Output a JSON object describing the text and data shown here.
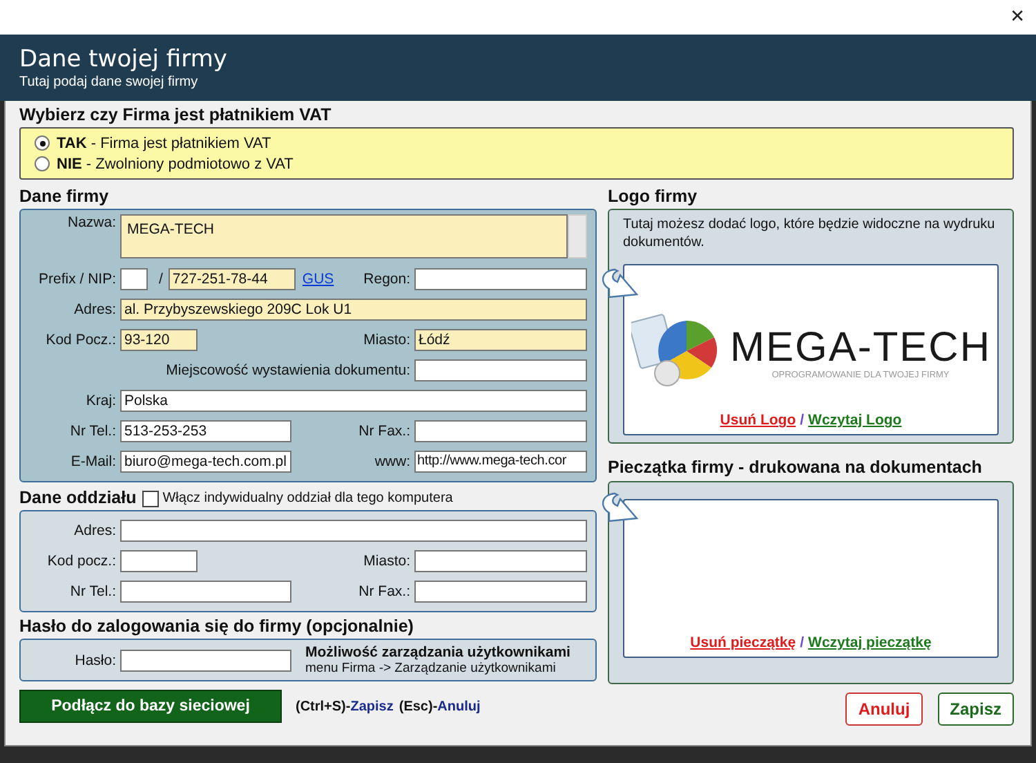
{
  "window": {
    "close": "✕"
  },
  "header": {
    "title": "Dane twojej firmy",
    "subtitle": "Tutaj podaj dane swojej firmy"
  },
  "vat": {
    "heading": "Wybierz czy Firma jest płatnikiem VAT",
    "options": [
      {
        "label": "**TAK** - Firma jest płatnikiem VAT",
        "selected": true
      },
      {
        "label": "**NIE** - Zwolniony podmiotowo z VAT",
        "selected": false
      }
    ]
  },
  "firm": {
    "heading": "Dane firmy",
    "name": {
      "label": "Nazwa:",
      "value": "MEGA-TECH",
      "required": true
    },
    "prefix": {
      "label": "Prefix / NIP:",
      "required": false
    },
    "separator": "/",
    "nip": {
      "value": "727-251-78-44",
      "required": true
    },
    "gus": "GUS",
    "regon": {
      "label": "Regon:",
      "required": false
    },
    "address": {
      "label": "Adres:",
      "value": "al. Przybyszewskiego 209C Lok U1",
      "required": true
    },
    "postcode": {
      "label": "Kod Pocz.:",
      "value": "93-120",
      "required": true
    },
    "city": {
      "label": "Miasto:",
      "value": "Łódź",
      "required": true
    },
    "issue_place": {
      "label": "Miejscowość wystawienia dokumentu:",
      "required": false
    },
    "country": {
      "label": "Kraj:",
      "value": "Polska",
      "required": false
    },
    "phone": {
      "label": "Nr Tel.:",
      "value": "513-253-253",
      "required": false
    },
    "fax": {
      "label": "Nr Fax.:",
      "required": false
    },
    "email": {
      "label": "E-Mail:",
      "value": "biuro@mega-tech.com.pl",
      "required": false
    },
    "www": {
      "label": "www:",
      "value": "http://www.mega-tech.cor",
      "required": false
    }
  },
  "branch": {
    "heading": "Dane oddziału",
    "checkbox": {
      "label": "Włącz indywidualny oddział dla tego komputera",
      "checked": false
    },
    "address": "Adres:",
    "postcode": "Kod pocz.:",
    "city": "Miasto:",
    "phone": "Nr Tel.:",
    "fax": "Nr Fax.:"
  },
  "password": {
    "heading": "Hasło do zalogowania się do firmy (opcjonalnie)",
    "label": "Hasło:",
    "note_title": "Możliwość zarządzania użytkownikami",
    "note": "menu Firma -> Zarządzanie użytkownikami"
  },
  "logo": {
    "heading": "Logo firmy",
    "hint": "Tutaj możesz dodać logo, które będzie widoczne na wydruku dokumentów.",
    "brand": "MEGA-TECH",
    "tagline": "OPROGRAMOWANIE DLA TWOJEJ FIRMY",
    "remove": "Usuń Logo",
    "slash": "/",
    "load": "Wczytaj Logo"
  },
  "stamp": {
    "heading": "Pieczątka firmy - drukowana na dokumentach",
    "remove": "Usuń pieczątkę",
    "slash": "/",
    "load": "Wczytaj pieczątkę"
  },
  "footer": {
    "connect": "Podłącz do bazy sieciowej",
    "shortcut_save_key": "(Ctrl+S)-",
    "save_link": "Zapisz",
    "shortcut_cancel_key": "(Esc)-",
    "cancel_link": "Anuluj",
    "cancel": "Anuluj",
    "save": "Zapisz"
  }
}
